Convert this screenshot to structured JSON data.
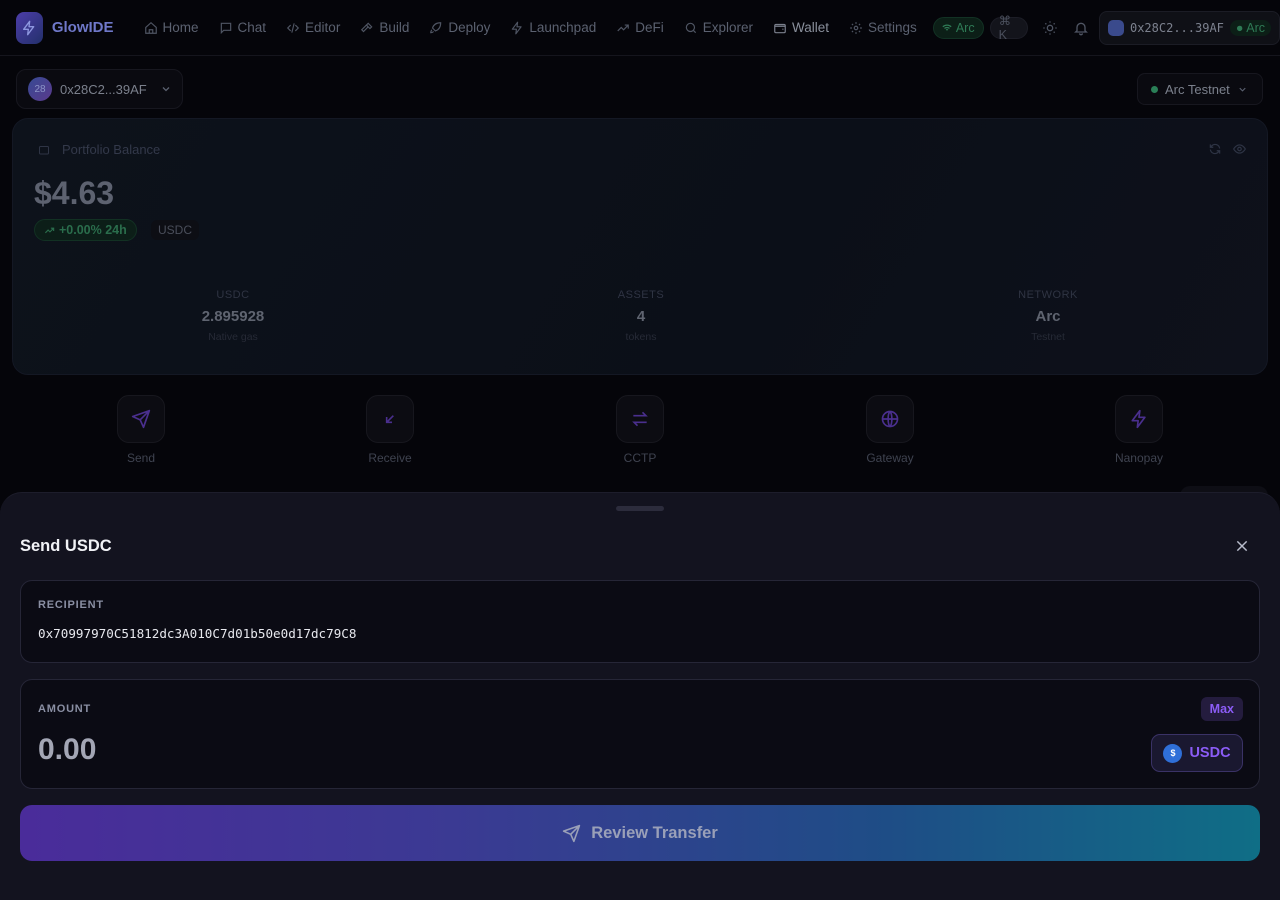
{
  "nav": {
    "brand": "GlowIDE",
    "items": [
      {
        "label": "Home",
        "icon": "home-icon"
      },
      {
        "label": "Chat",
        "icon": "chat-icon"
      },
      {
        "label": "Editor",
        "icon": "code-icon"
      },
      {
        "label": "Build",
        "icon": "hammer-icon"
      },
      {
        "label": "Deploy",
        "icon": "rocket-icon"
      },
      {
        "label": "Launchpad",
        "icon": "bolt-icon"
      },
      {
        "label": "DeFi",
        "icon": "trend-up-icon"
      },
      {
        "label": "Explorer",
        "icon": "search-icon"
      },
      {
        "label": "Wallet",
        "icon": "wallet-icon",
        "active": true
      },
      {
        "label": "Settings",
        "icon": "gear-icon"
      }
    ],
    "network_pill": "Arc",
    "shortcut_pill": "⌘ K",
    "wallet_address": "0x28C2...39AF",
    "wallet_network": "Arc"
  },
  "account": {
    "avatar_text": "28",
    "address": "0x28C2...39AF",
    "network": "Arc Testnet"
  },
  "portfolio": {
    "title": "Portfolio Balance",
    "balance": "$4.63",
    "change": "+0.00% 24h",
    "currency": "USDC",
    "stats": [
      {
        "label": "USDC",
        "value": "2.895928",
        "sub": "Native gas"
      },
      {
        "label": "ASSETS",
        "value": "4",
        "sub": "tokens"
      },
      {
        "label": "NETWORK",
        "value": "Arc",
        "sub": "Testnet"
      }
    ]
  },
  "actions": [
    {
      "label": "Send",
      "icon": "send-icon"
    },
    {
      "label": "Receive",
      "icon": "arrow-down-left-icon"
    },
    {
      "label": "CCTP",
      "icon": "swap-arrows-icon"
    },
    {
      "label": "Gateway",
      "icon": "globe-icon"
    },
    {
      "label": "Nanopay",
      "icon": "bolt-icon"
    }
  ],
  "send_sheet": {
    "title": "Send USDC",
    "recipient_label": "RECIPIENT",
    "recipient_value": "0x70997970C51812dc3A010C7d01b50e0d17dc79C8",
    "amount_label": "AMOUNT",
    "max_label": "Max",
    "amount_value": "0.00",
    "token_label": "USDC",
    "token_symbol": "$",
    "review_label": "Review Transfer"
  },
  "colors": {
    "accent_purple": "#8b5cf6",
    "success_green": "#2a7f57",
    "sheet_bg": "#13131f"
  }
}
